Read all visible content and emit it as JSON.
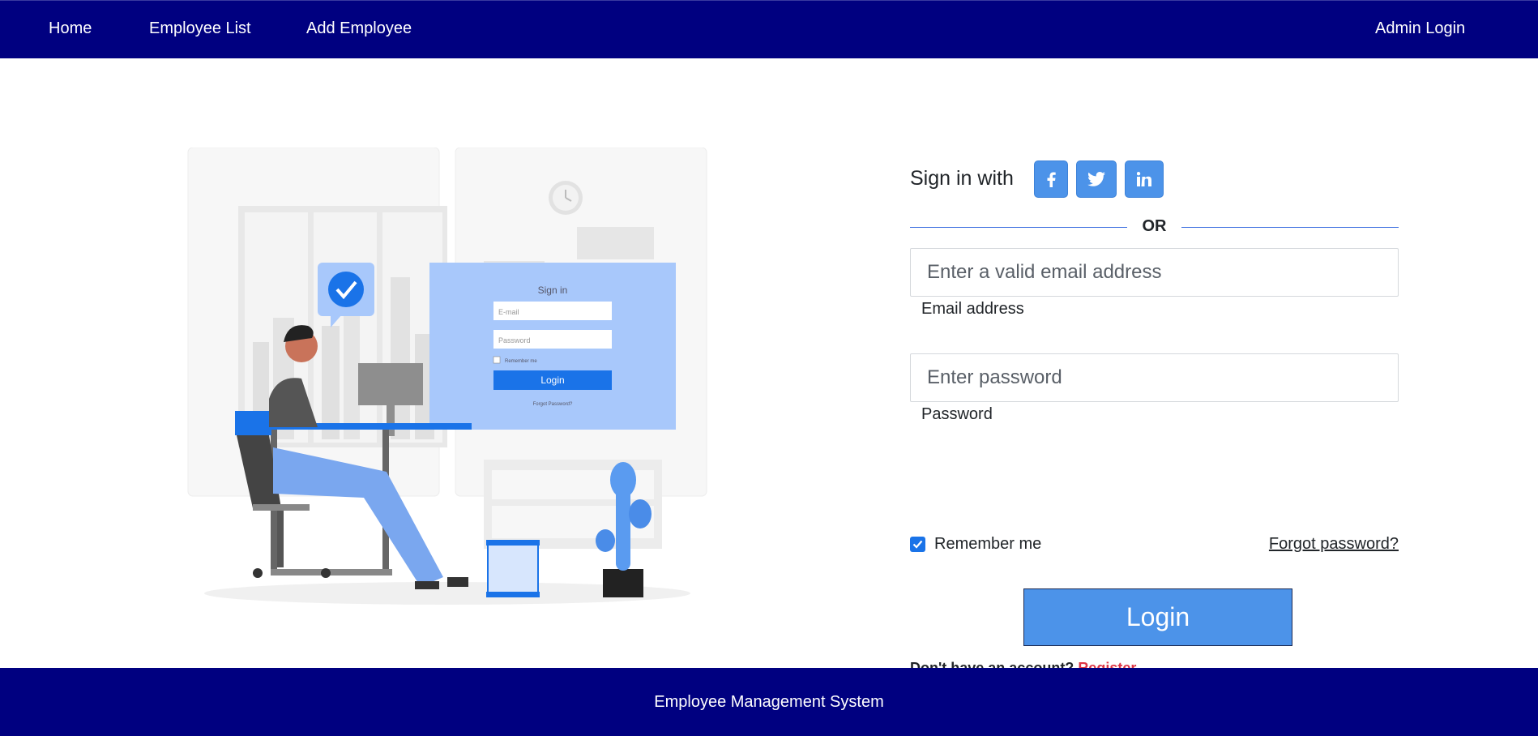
{
  "nav": {
    "home": "Home",
    "employee_list": "Employee List",
    "add_employee": "Add Employee",
    "admin_login": "Admin Login"
  },
  "illustration": {
    "sign_in": "Sign in",
    "email_placeholder": "E-mail",
    "password_placeholder": "Password",
    "remember": "Remember me",
    "login": "Login",
    "forgot": "Forgot Password?"
  },
  "form": {
    "sign_in_with": "Sign in with",
    "social": [
      "facebook-icon",
      "twitter-icon",
      "linkedin-icon"
    ],
    "or": "OR",
    "email_placeholder": "Enter a valid email address",
    "email_label": "Email address",
    "password_placeholder": "Enter password",
    "password_label": "Password",
    "remember_me": "Remember me",
    "remember_checked": true,
    "forgot_password": "Forgot password?",
    "login_button": "Login",
    "no_account": "Don't have an account?",
    "register": "Register"
  },
  "footer": {
    "text": "Employee Management System"
  },
  "colors": {
    "navbar": "#000080",
    "accent": "#4c93e9",
    "register": "#dc3545"
  }
}
